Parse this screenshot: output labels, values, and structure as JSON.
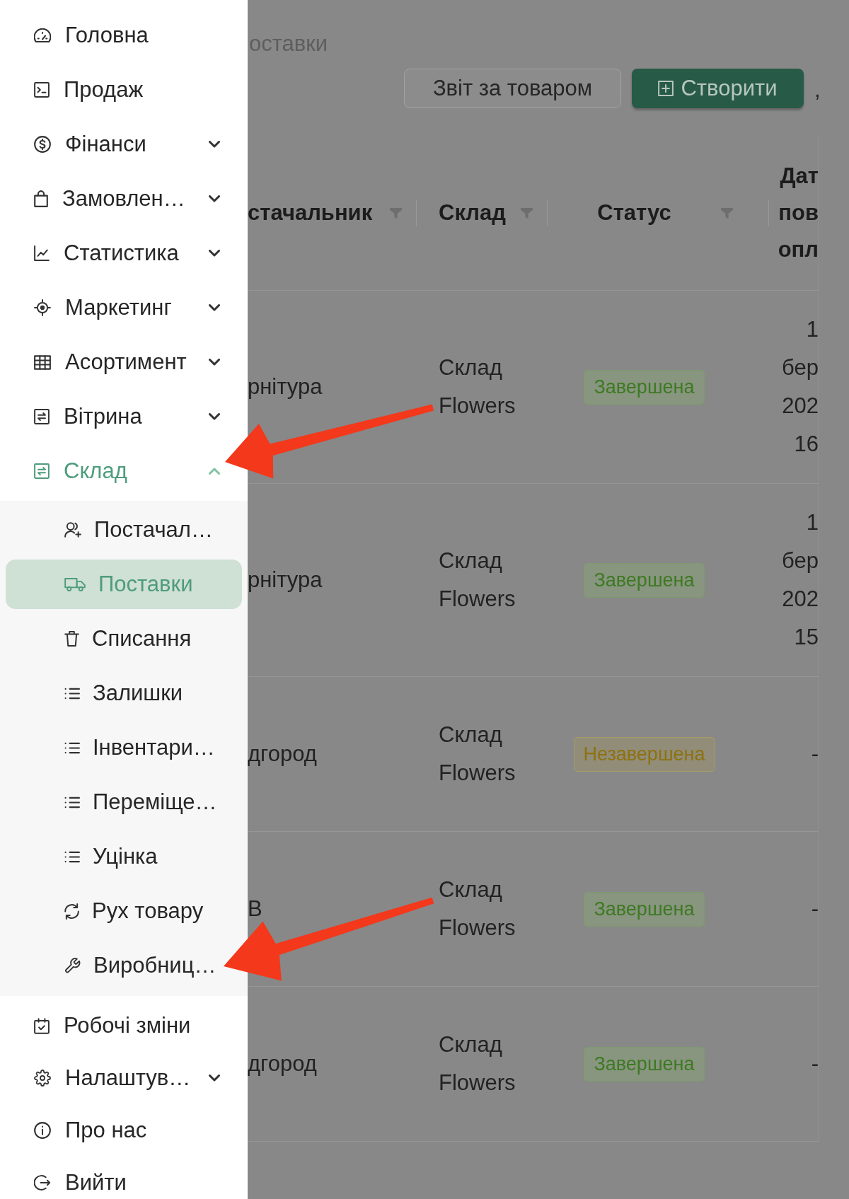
{
  "sidebar": {
    "items": [
      {
        "label": "Головна",
        "kind": "link",
        "selected": false
      },
      {
        "label": "Продаж",
        "kind": "link",
        "selected": false
      },
      {
        "label": "Фінанси",
        "kind": "group",
        "selected": false,
        "expanded": false
      },
      {
        "label": "Замовлен…",
        "kind": "group",
        "selected": false,
        "expanded": false
      },
      {
        "label": "Статистика",
        "kind": "group",
        "selected": false,
        "expanded": false
      },
      {
        "label": "Маркетинг",
        "kind": "group",
        "selected": false,
        "expanded": false
      },
      {
        "label": "Асортимент",
        "kind": "group",
        "selected": false,
        "expanded": false
      },
      {
        "label": "Вітрина",
        "kind": "group",
        "selected": false,
        "expanded": false
      },
      {
        "label": "Склад",
        "kind": "group",
        "selected": true,
        "expanded": true,
        "children": [
          {
            "label": "Постачал…",
            "selected": false
          },
          {
            "label": "Поставки",
            "selected": true
          },
          {
            "label": "Списання",
            "selected": false
          },
          {
            "label": "Залишки",
            "selected": false
          },
          {
            "label": "Інвентари…",
            "selected": false
          },
          {
            "label": "Переміще…",
            "selected": false
          },
          {
            "label": "Уцінка",
            "selected": false
          },
          {
            "label": "Рух товару",
            "selected": false
          },
          {
            "label": "Виробниц…",
            "selected": false
          }
        ]
      },
      {
        "label": "Робочі зміни",
        "kind": "link",
        "selected": false
      },
      {
        "label": "Налаштув…",
        "kind": "group",
        "selected": false,
        "expanded": false
      },
      {
        "label": "Про нас",
        "kind": "link",
        "selected": false
      },
      {
        "label": "Вийти",
        "kind": "link",
        "selected": false
      }
    ]
  },
  "breadcrumb": "оставки",
  "toolbar": {
    "buttons": [
      {
        "label": "Звіт за товаром",
        "kind": "secondary"
      },
      {
        "label": "Створити",
        "kind": "primary"
      }
    ],
    "cut_off_text": ","
  },
  "table": {
    "columns": [
      {
        "label": "стачальник",
        "filterable": true
      },
      {
        "label": "Склад",
        "filterable": true
      },
      {
        "label": "Статус",
        "filterable": true
      },
      {
        "label": "Дат пов опл",
        "filterable": false
      }
    ],
    "rows": [
      {
        "column_1": "рнітура",
        "warehouse": "Склад Flowers",
        "status": {
          "label": "Завершена",
          "kind": "complete"
        },
        "column_4": "1 бер 202 16"
      },
      {
        "column_1": "рнітура",
        "warehouse": "Склад Flowers",
        "status": {
          "label": "Завершена",
          "kind": "complete"
        },
        "column_4": "1 бер 202 15"
      },
      {
        "column_1": "дгород",
        "warehouse": "Склад Flowers",
        "status": {
          "label": "Незавершена",
          "kind": "incomplete"
        },
        "column_4": "-"
      },
      {
        "column_1": "В",
        "warehouse": "Склад Flowers",
        "status": {
          "label": "Завершена",
          "kind": "complete"
        },
        "column_4": "-"
      },
      {
        "column_1": "дгород",
        "warehouse": "Склад Flowers",
        "status": {
          "label": "Завершена",
          "kind": "complete"
        },
        "column_4": "-"
      }
    ]
  },
  "annotations": [
    {
      "kind": "arrow"
    },
    {
      "kind": "arrow"
    }
  ]
}
